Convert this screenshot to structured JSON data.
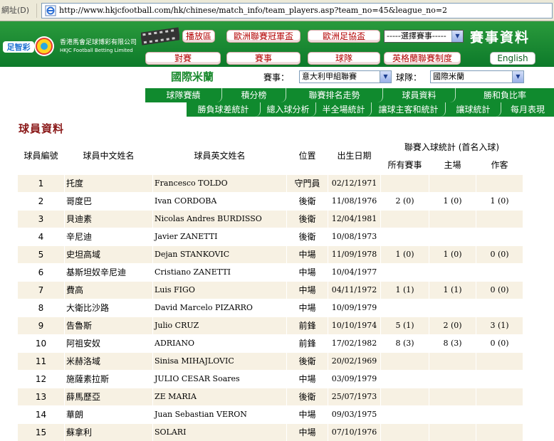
{
  "browser": {
    "address_label": "網址(D)",
    "url": "http://www.hkjcfootball.com/hk/chinese/match_info/team_players.asp?team_no=45&league_no=2"
  },
  "header": {
    "company_cn": "香港馬會足球博彩有限公司",
    "company_en": "HKJC Football Betting Limited",
    "logo_text": "足智彩",
    "section_title": "賽事資料",
    "english_button": "English",
    "nav_top": [
      "播放區",
      "歐洲聯賽冠軍盃",
      "歐洲足協盃"
    ],
    "nav_bottom": [
      "對賽",
      "賽事",
      "球隊",
      "英格蘭聯賽制度"
    ],
    "event_select": "-----選擇賽事-----"
  },
  "team_bar": {
    "team_name": "國際米蘭",
    "league_label": "賽事：",
    "league_value": "意大利甲組聯賽",
    "team_label": "球隊：",
    "team_value": "國際米蘭"
  },
  "tabs_row1": [
    "球隊賽績",
    "積分榜",
    "聯賽排名走勢",
    "球員資料",
    "勝和負比率"
  ],
  "tabs_row2": [
    "勝負球差統計",
    "總入球分析",
    "半全場統計",
    "讓球主客和統計",
    "讓球統計",
    "每月表現"
  ],
  "page_title": "球員資料",
  "table": {
    "headers": {
      "number": "球員編號",
      "cn_name": "球員中文姓名",
      "en_name": "球員英文姓名",
      "position": "位置",
      "dob": "出生日期",
      "goal_stats": "聯賽入球統計 (首名入球)",
      "all": "所有賽事",
      "home": "主場",
      "away": "作客"
    },
    "rows": [
      {
        "no": "1",
        "cn": "托度",
        "en": "Francesco TOLDO",
        "pos": "守門員",
        "dob": "02/12/1971",
        "all": "",
        "home": "",
        "away": ""
      },
      {
        "no": "2",
        "cn": "哥度巴",
        "en": "Ivan CORDOBA",
        "pos": "後衛",
        "dob": "11/08/1976",
        "all": "2  (0)",
        "home": "1  (0)",
        "away": "1  (0)"
      },
      {
        "no": "3",
        "cn": "貝迪素",
        "en": "Nicolas Andres BURDISSO",
        "pos": "後衛",
        "dob": "12/04/1981",
        "all": "",
        "home": "",
        "away": ""
      },
      {
        "no": "4",
        "cn": "辛尼迪",
        "en": "Javier ZANETTI",
        "pos": "後衛",
        "dob": "10/08/1973",
        "all": "",
        "home": "",
        "away": ""
      },
      {
        "no": "5",
        "cn": "史坦高域",
        "en": "Dejan STANKOVIC",
        "pos": "中場",
        "dob": "11/09/1978",
        "all": "1  (0)",
        "home": "1  (0)",
        "away": "0  (0)"
      },
      {
        "no": "6",
        "cn": "基斯坦奴辛尼迪",
        "en": "Cristiano ZANETTI",
        "pos": "中場",
        "dob": "10/04/1977",
        "all": "",
        "home": "",
        "away": ""
      },
      {
        "no": "7",
        "cn": "費高",
        "en": "Luis FIGO",
        "pos": "中場",
        "dob": "04/11/1972",
        "all": "1  (1)",
        "home": "1  (1)",
        "away": "0  (0)"
      },
      {
        "no": "8",
        "cn": "大衛比沙路",
        "en": "David Marcelo PIZARRO",
        "pos": "中場",
        "dob": "10/09/1979",
        "all": "",
        "home": "",
        "away": ""
      },
      {
        "no": "9",
        "cn": "告魯斯",
        "en": "Julio CRUZ",
        "pos": "前鋒",
        "dob": "10/10/1974",
        "all": "5  (1)",
        "home": "2  (0)",
        "away": "3  (1)"
      },
      {
        "no": "10",
        "cn": "阿祖安奴",
        "en": "ADRIANO",
        "pos": "前鋒",
        "dob": "17/02/1982",
        "all": "8  (3)",
        "home": "8  (3)",
        "away": "0  (0)"
      },
      {
        "no": "11",
        "cn": "米赫洛域",
        "en": "Sinisa MIHAJLOVIC",
        "pos": "後衛",
        "dob": "20/02/1969",
        "all": "",
        "home": "",
        "away": ""
      },
      {
        "no": "12",
        "cn": "施薩素拉斯",
        "en": "JULIO CESAR Soares",
        "pos": "中場",
        "dob": "03/09/1979",
        "all": "",
        "home": "",
        "away": ""
      },
      {
        "no": "13",
        "cn": "薛馬歷亞",
        "en": "ZE MARIA",
        "pos": "後衛",
        "dob": "25/07/1973",
        "all": "",
        "home": "",
        "away": ""
      },
      {
        "no": "14",
        "cn": "華朗",
        "en": "Juan Sebastian VERON",
        "pos": "中場",
        "dob": "09/03/1975",
        "all": "",
        "home": "",
        "away": ""
      },
      {
        "no": "15",
        "cn": "蘇拿利",
        "en": "SOLARI",
        "pos": "中場",
        "dob": "07/10/1976",
        "all": "",
        "home": "",
        "away": ""
      }
    ]
  },
  "colors": {
    "header_green": "#108a2e",
    "title_red": "#8b1a1a",
    "row_stripe": "#f7f1e3",
    "button_text": "#b30000"
  }
}
